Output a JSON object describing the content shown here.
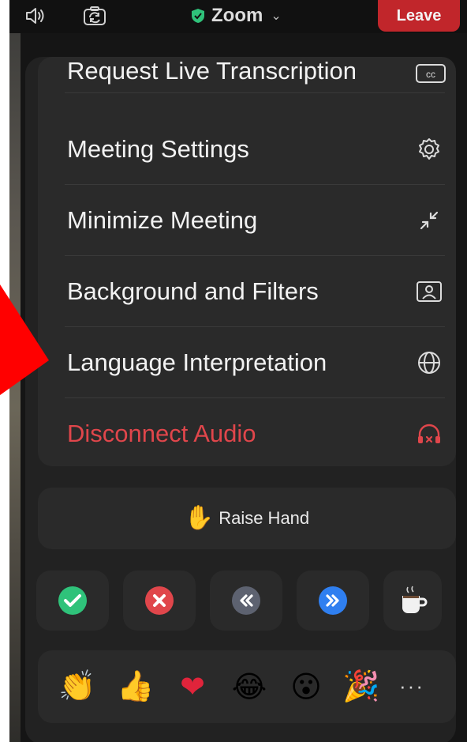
{
  "app": {
    "title": "Zoom",
    "leave_label": "Leave",
    "accent_red": "#c1262b",
    "shield_color": "#2fc27a"
  },
  "menu": {
    "items": [
      {
        "label": "Request Live Transcription",
        "icon": "closed-captions-icon"
      },
      {
        "label": "Meeting Settings",
        "icon": "gear-icon"
      },
      {
        "label": "Minimize Meeting",
        "icon": "minimize-arrows-icon"
      },
      {
        "label": "Background and Filters",
        "icon": "portrait-frame-icon"
      },
      {
        "label": "Language Interpretation",
        "icon": "globe-icon"
      },
      {
        "label": "Disconnect Audio",
        "icon": "headphones-disconnect-icon",
        "danger_color": "#e0464b"
      }
    ]
  },
  "raise_hand": {
    "label": "Raise Hand",
    "icon": "raised-hand-icon"
  },
  "reactions": [
    {
      "name": "yes",
      "icon": "green-check-icon"
    },
    {
      "name": "no",
      "icon": "red-x-icon"
    },
    {
      "name": "slower",
      "icon": "rewind-icon"
    },
    {
      "name": "faster",
      "icon": "fast-forward-icon"
    },
    {
      "name": "coffee",
      "icon": "coffee-icon"
    }
  ],
  "emojis": {
    "items": [
      {
        "name": "clap",
        "glyph": "👏"
      },
      {
        "name": "thumbs-up",
        "glyph": "👍"
      },
      {
        "name": "heart",
        "glyph": "❤"
      },
      {
        "name": "tears-of-joy",
        "glyph": "😂"
      },
      {
        "name": "surprised",
        "glyph": "😮"
      },
      {
        "name": "party-popper",
        "glyph": "🎉"
      }
    ],
    "more_label": "···"
  }
}
